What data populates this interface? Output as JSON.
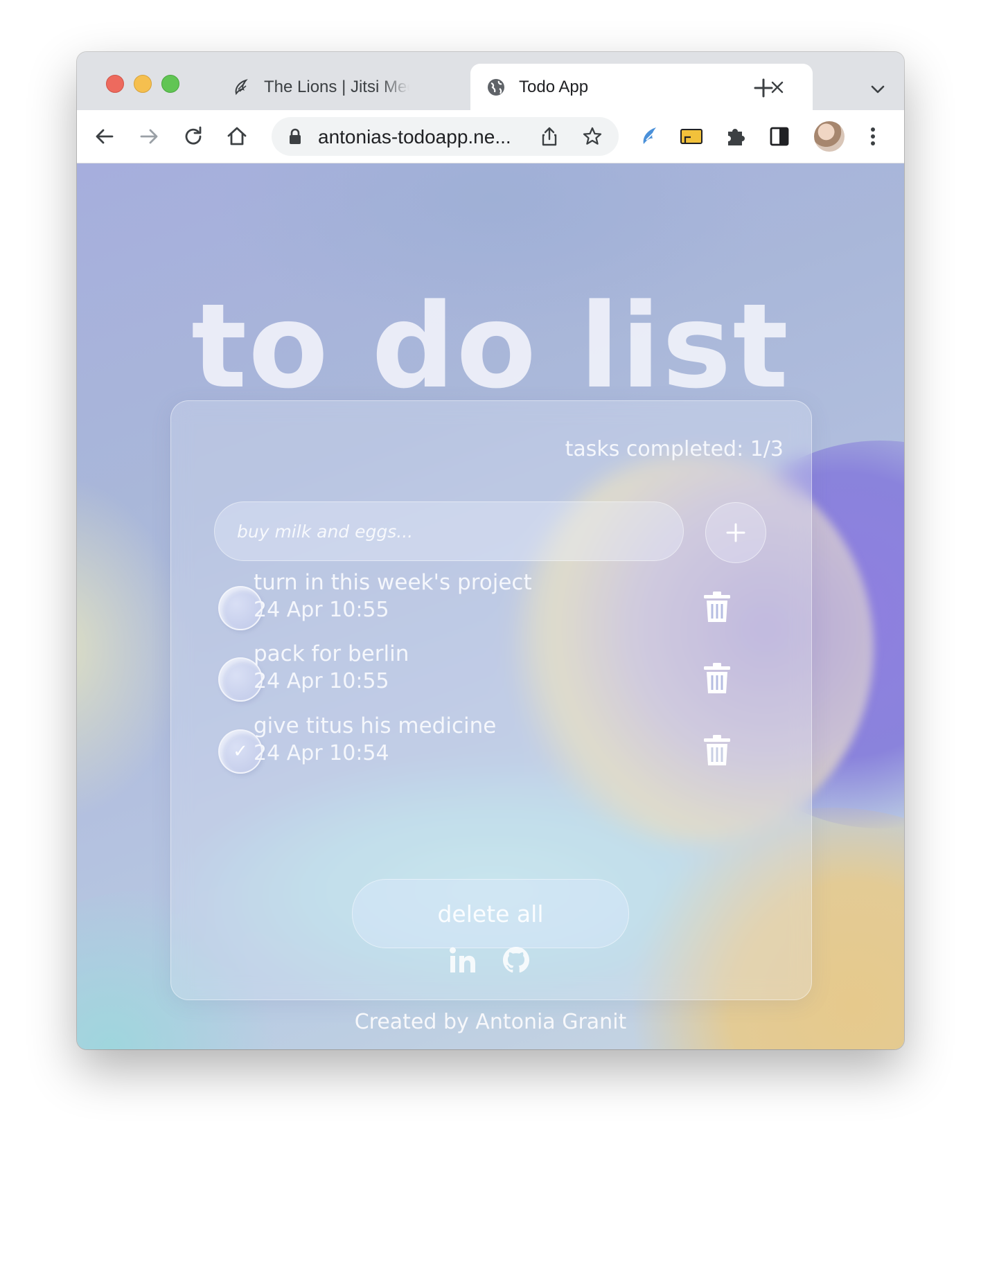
{
  "browser": {
    "tabs": [
      {
        "title": "The Lions | Jitsi Meet",
        "favicon": "jitsi-icon",
        "recording": true
      },
      {
        "title": "Todo App",
        "favicon": "globe-icon",
        "active": true
      }
    ],
    "url": "antonias-todoapp.ne..."
  },
  "page": {
    "title": "to do list",
    "counter": "tasks completed: 1/3",
    "input_placeholder": "buy milk and eggs...",
    "add_label": "+",
    "tasks": [
      {
        "text": "turn in this week's project",
        "date": "24 Apr 10:55",
        "done": false
      },
      {
        "text": "pack for berlin",
        "date": "24 Apr 10:55",
        "done": false
      },
      {
        "text": "give titus his medicine",
        "date": "24 Apr 10:54",
        "done": true
      }
    ],
    "check_mark": "✓",
    "delete_all": "delete all",
    "footer": "Created by Antonia Granit",
    "social": [
      "linkedin-icon",
      "github-icon"
    ]
  },
  "colors": {
    "accent_purple": "#8f7fe0",
    "accent_gold": "#e6c98c",
    "text_light": "#f5f7fc"
  }
}
